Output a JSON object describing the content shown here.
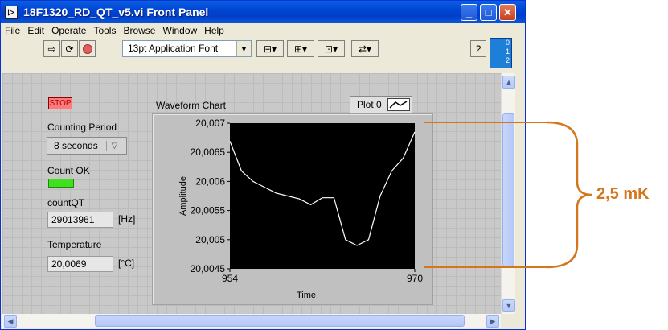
{
  "window": {
    "title": "18F1320_RD_QT_v5.vi Front Panel",
    "title_icon": "labview-vi-icon",
    "buttons": {
      "minimize": "minimize-icon",
      "maximize": "maximize-icon",
      "close": "close-icon"
    }
  },
  "menu": [
    {
      "first": "F",
      "rest": "ile"
    },
    {
      "first": "E",
      "rest": "dit"
    },
    {
      "first": "O",
      "rest": "perate"
    },
    {
      "first": "T",
      "rest": "ools"
    },
    {
      "first": "B",
      "rest": "rowse"
    },
    {
      "first": "W",
      "rest": "indow"
    },
    {
      "first": "H",
      "rest": "elp"
    }
  ],
  "toolbar": {
    "font_selector": "13pt Application Font",
    "icons": [
      "run-arrow-icon",
      "run-continuously-icon",
      "abort-stop-icon",
      "align-objects-icon",
      "distribute-objects-icon",
      "resize-objects-icon",
      "reorder-icon",
      "context-help-icon"
    ]
  },
  "context_help_box": {
    "lines": [
      "0",
      "1",
      "2"
    ]
  },
  "controls": {
    "stop_label": "STOP",
    "counting_period_label": "Counting Period",
    "counting_period_value": "8 seconds",
    "count_ok_label": "Count OK",
    "count_ok_state": true,
    "countqt_label": "countQT",
    "countqt_value": "29013961",
    "countqt_unit": "[Hz]",
    "temperature_label": "Temperature",
    "temperature_value": "20,0069",
    "temperature_unit": "[°C]"
  },
  "annotation": {
    "text": "2,5 mK",
    "color": "#d4761a"
  },
  "colors": {
    "plot_background": "#000000",
    "plot_line": "#ffffff",
    "led_on": "#41e01e",
    "stop_button": "#ff7b7b",
    "titlebar": "#0a5fe0"
  },
  "chart_data": {
    "type": "line",
    "title": "Waveform Chart",
    "legend": "Plot 0",
    "xlabel": "Time",
    "ylabel": "Amplitude",
    "xlim": [
      954,
      970
    ],
    "ylim": [
      20.0045,
      20.007
    ],
    "x_tick_labels": [
      "954",
      "970"
    ],
    "y_tick_labels": [
      "20,007",
      "20,0065",
      "20,006",
      "20,0055",
      "20,005",
      "20,0045"
    ],
    "grid": false,
    "series": [
      {
        "name": "Plot 0",
        "x": [
          954,
          955,
          956,
          957,
          958,
          959,
          960,
          961,
          962,
          963,
          964,
          965,
          966,
          967,
          968,
          969,
          970
        ],
        "values": [
          20.00669,
          20.00618,
          20.006,
          20.0059,
          20.0058,
          20.00575,
          20.0057,
          20.0056,
          20.00572,
          20.00572,
          20.005,
          20.0049,
          20.005,
          20.00575,
          20.00618,
          20.0064,
          20.00685
        ]
      }
    ]
  }
}
